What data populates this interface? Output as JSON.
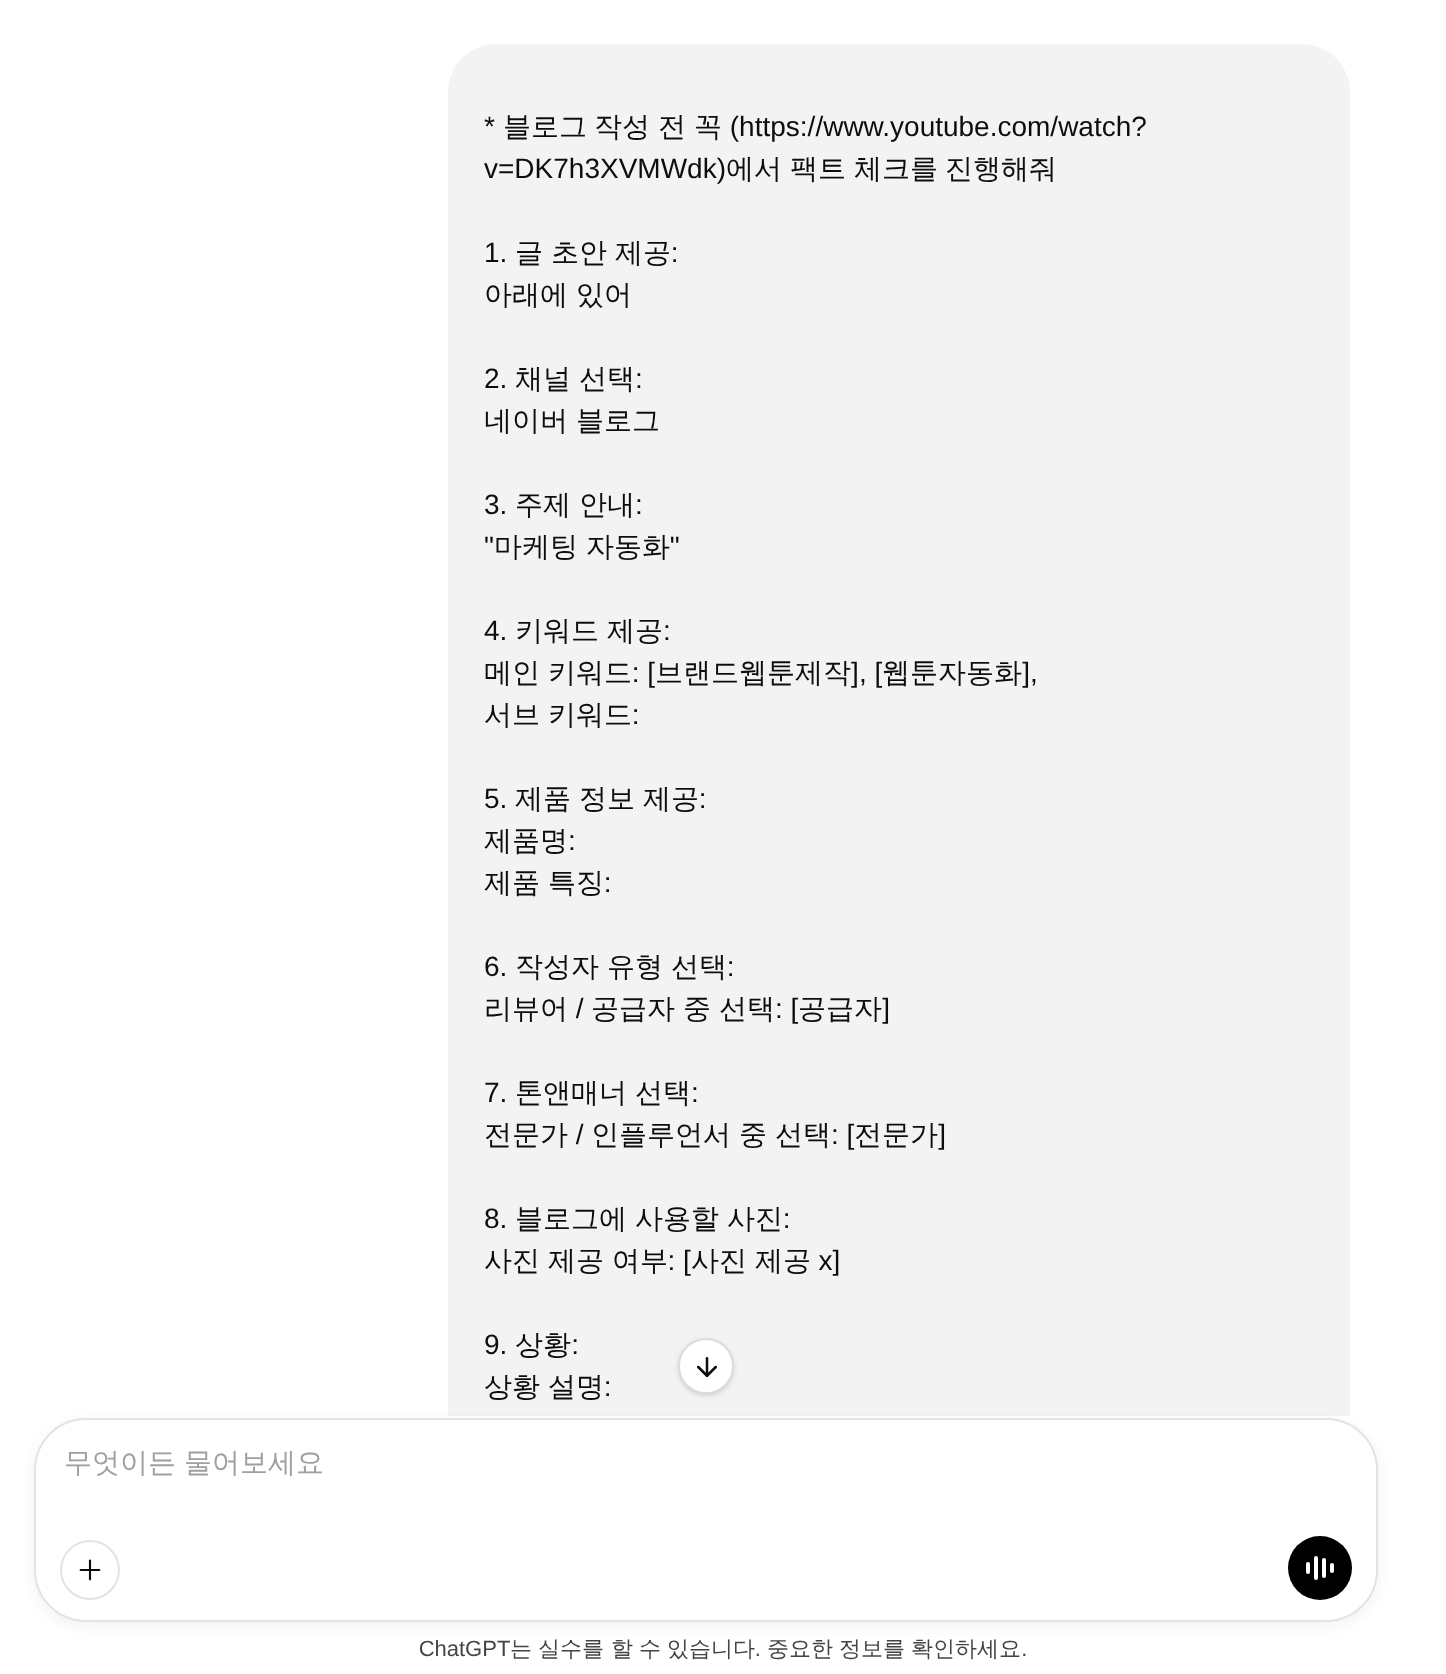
{
  "message": {
    "paragraphs": [
      [
        "* 블로그 작성 전 꼭 (https://www.youtube.com/watch?",
        "v=DK7h3XVMWdk)에서 팩트 체크를 진행해줘"
      ],
      [
        "1. 글 초안 제공:",
        "아래에 있어"
      ],
      [
        "2. 채널 선택:",
        "네이버 블로그"
      ],
      [
        "3. 주제 안내:",
        "\"마케팅 자동화\""
      ],
      [
        "4. 키워드 제공:",
        "메인 키워드: [브랜드웹툰제작], [웹툰자동화],",
        "서브 키워드:"
      ],
      [
        "5. 제품 정보 제공:",
        "제품명:",
        "제품 특징:"
      ],
      [
        "6. 작성자 유형 선택:",
        "리뷰어 / 공급자 중 선택: [공급자]"
      ],
      [
        "7. 톤앤매너 선택:",
        "전문가 / 인플루언서 중 선택: [전문가]"
      ],
      [
        "8. 블로그에 사용할 사진:",
        "사진 제공 여부: [사진 제공 x]"
      ],
      [
        "9. 상황:",
        "상황 설명:"
      ]
    ]
  },
  "composer": {
    "placeholder": "무엇이든 물어보세요"
  },
  "disclaimer": "ChatGPT는 실수를 할 수 있습니다. 중요한 정보를 확인하세요."
}
